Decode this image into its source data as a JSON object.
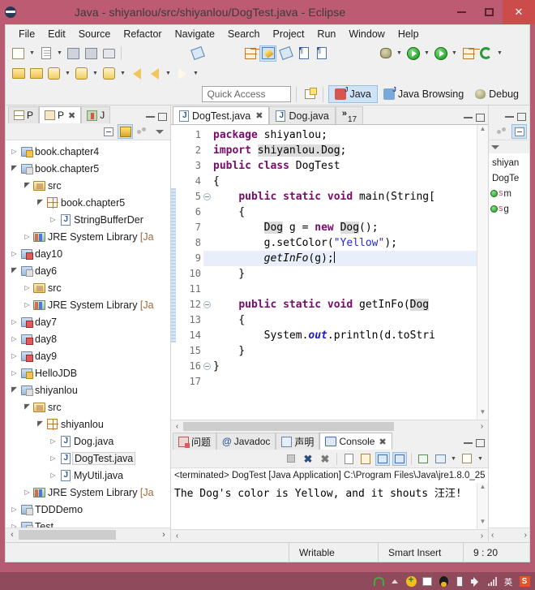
{
  "window": {
    "title": "Java - shiyanlou/src/shiyanlou/DogTest.java - Eclipse",
    "logo_icon": "eclipse-logo-icon",
    "minimize_label": "Minimize",
    "maximize_label": "Maximize",
    "close_label": "Close"
  },
  "menu": {
    "items": [
      {
        "label": "File"
      },
      {
        "label": "Edit"
      },
      {
        "label": "Source"
      },
      {
        "label": "Refactor"
      },
      {
        "label": "Navigate"
      },
      {
        "label": "Search"
      },
      {
        "label": "Project"
      },
      {
        "label": "Run"
      },
      {
        "label": "Window"
      },
      {
        "label": "Help"
      }
    ]
  },
  "toolbar": {
    "row1_icons": [
      "new-wizard-icon",
      "new-dropdown-icon",
      "new-java-class-icon",
      "new-class-dropdown-icon",
      "save-icon",
      "save-all-icon",
      "print-icon",
      "toggle-mark-occurrences-icon",
      "new-java-project-icon",
      "open-type-icon",
      "external-tools-icon",
      "show-whitespace-icon",
      "show-print-margin-icon",
      "debug-icon",
      "debug-dropdown-icon",
      "run-icon",
      "run-dropdown-icon",
      "run-external-tools-icon",
      "external-dropdown-icon",
      "new-package-icon",
      "refresh-icon",
      "refresh-dropdown-icon"
    ],
    "row2_icons": [
      "open-resource-icon",
      "open-folder-icon",
      "launch-icon",
      "launch-dropdown-icon",
      "previous-annotation-icon",
      "prev-dropdown-icon",
      "next-annotation-icon",
      "next-dropdown-icon",
      "back-history-icon",
      "back-icon",
      "back-dropdown-icon",
      "forward-icon",
      "forward-dropdown-icon"
    ]
  },
  "quick_access": {
    "placeholder": "Quick Access",
    "value": "Quick Access",
    "open_perspective_icon": "open-perspective-icon",
    "perspectives": [
      {
        "label": "Java",
        "icon": "java-perspective-icon",
        "active": true
      },
      {
        "label": "Java Browsing",
        "icon": "java-browsing-perspective-icon",
        "active": false
      },
      {
        "label": "Debug",
        "icon": "debug-perspective-icon",
        "active": false
      }
    ]
  },
  "package_explorer": {
    "tabs": [
      {
        "label": "P",
        "icon": "package-presentation-icon",
        "active": false,
        "closeable": false
      },
      {
        "label": "P",
        "icon": "package-explorer-icon",
        "active": true,
        "closeable": true
      },
      {
        "label": "J",
        "icon": "junit-icon",
        "active": false,
        "closeable": false
      }
    ],
    "toolbar_icons": [
      "collapse-all-icon",
      "link-with-editor-icon",
      "view-menu-dots-icon",
      "view-menu-icon"
    ],
    "tree": [
      {
        "indent": 0,
        "twisty": "collapsed",
        "icon": "project-warning-icon",
        "label": "book.chapter4"
      },
      {
        "indent": 0,
        "twisty": "expanded",
        "icon": "project-icon",
        "label": "book.chapter5"
      },
      {
        "indent": 1,
        "twisty": "expanded",
        "icon": "source-folder-icon",
        "label": "src"
      },
      {
        "indent": 2,
        "twisty": "expanded",
        "icon": "package-icon",
        "label": "book.chapter5"
      },
      {
        "indent": 3,
        "twisty": "collapsed",
        "icon": "java-file-icon",
        "label": "StringBufferDer"
      },
      {
        "indent": 1,
        "twisty": "collapsed",
        "icon": "jre-library-icon",
        "label": "JRE System Library ",
        "dim": "[Ja"
      },
      {
        "indent": 0,
        "twisty": "collapsed",
        "icon": "project-error-icon",
        "label": "day10"
      },
      {
        "indent": 0,
        "twisty": "expanded",
        "icon": "project-icon",
        "label": "day6"
      },
      {
        "indent": 1,
        "twisty": "collapsed",
        "icon": "source-folder-icon",
        "label": "src"
      },
      {
        "indent": 1,
        "twisty": "collapsed",
        "icon": "jre-library-icon",
        "label": "JRE System Library ",
        "dim": "[Ja"
      },
      {
        "indent": 0,
        "twisty": "collapsed",
        "icon": "project-error-icon",
        "label": "day7"
      },
      {
        "indent": 0,
        "twisty": "collapsed",
        "icon": "project-error-icon",
        "label": "day8"
      },
      {
        "indent": 0,
        "twisty": "collapsed",
        "icon": "project-error-icon",
        "label": "day9"
      },
      {
        "indent": 0,
        "twisty": "collapsed",
        "icon": "project-warning-icon",
        "label": "HelloJDB"
      },
      {
        "indent": 0,
        "twisty": "expanded",
        "icon": "project-icon",
        "label": "shiyanlou"
      },
      {
        "indent": 1,
        "twisty": "expanded",
        "icon": "source-folder-icon",
        "label": "src"
      },
      {
        "indent": 2,
        "twisty": "expanded",
        "icon": "package-icon",
        "label": "shiyanlou"
      },
      {
        "indent": 3,
        "twisty": "collapsed",
        "icon": "java-file-icon",
        "label": "Dog.java"
      },
      {
        "indent": 3,
        "twisty": "collapsed",
        "icon": "java-file-icon",
        "label": "DogTest.java",
        "selected": true
      },
      {
        "indent": 3,
        "twisty": "collapsed",
        "icon": "java-file-icon",
        "label": "MyUtil.java"
      },
      {
        "indent": 1,
        "twisty": "collapsed",
        "icon": "jre-library-icon",
        "label": "JRE System Library ",
        "dim": "[Ja"
      },
      {
        "indent": 0,
        "twisty": "collapsed",
        "icon": "project-icon",
        "label": "TDDDemo"
      },
      {
        "indent": 0,
        "twisty": "collapsed",
        "icon": "project-icon",
        "label": "Test"
      }
    ]
  },
  "editor": {
    "tabs": [
      {
        "label": "DogTest.java",
        "icon": "java-file-icon",
        "active": true,
        "closeable": true
      },
      {
        "label": "Dog.java",
        "icon": "java-file-icon",
        "active": false,
        "closeable": false
      }
    ],
    "overflow": {
      "chevron": "»",
      "count": "17"
    },
    "minimize_label": "Minimize",
    "maximize_label": "Maximize",
    "line_numbers": [
      "1",
      "2",
      "3",
      "4",
      "5",
      "6",
      "7",
      "8",
      "9",
      "10",
      "11",
      "12",
      "13",
      "14",
      "15",
      "16",
      "17"
    ],
    "fold_lines": [
      "5",
      "12",
      "16"
    ],
    "current_line": "9",
    "lines": [
      {
        "n": "1",
        "tokens": [
          {
            "t": "package ",
            "c": "kw"
          },
          {
            "t": "shiyanlou;",
            "c": ""
          }
        ]
      },
      {
        "n": "2",
        "tokens": [
          {
            "t": "import ",
            "c": "kw"
          },
          {
            "t": "shiyanlou.Dog",
            "c": "occ"
          },
          {
            "t": ";",
            "c": ""
          }
        ]
      },
      {
        "n": "3",
        "tokens": [
          {
            "t": "public class ",
            "c": "kw"
          },
          {
            "t": "DogTest",
            "c": ""
          }
        ]
      },
      {
        "n": "4",
        "tokens": [
          {
            "t": "{",
            "c": ""
          }
        ]
      },
      {
        "n": "5",
        "tokens": [
          {
            "t": "    ",
            "c": ""
          },
          {
            "t": "public static void ",
            "c": "kw"
          },
          {
            "t": "main(String[",
            "c": ""
          }
        ]
      },
      {
        "n": "6",
        "tokens": [
          {
            "t": "    {",
            "c": ""
          }
        ]
      },
      {
        "n": "7",
        "tokens": [
          {
            "t": "        ",
            "c": ""
          },
          {
            "t": "Dog",
            "c": "occ"
          },
          {
            "t": " g = ",
            "c": ""
          },
          {
            "t": "new ",
            "c": "kw"
          },
          {
            "t": "Dog",
            "c": "occ"
          },
          {
            "t": "();",
            "c": ""
          }
        ]
      },
      {
        "n": "8",
        "tokens": [
          {
            "t": "        g.setColor(",
            "c": ""
          },
          {
            "t": "\"Yellow\"",
            "c": "str"
          },
          {
            "t": ");",
            "c": ""
          }
        ]
      },
      {
        "n": "9",
        "tokens": [
          {
            "t": "        ",
            "c": ""
          },
          {
            "t": "getInFo",
            "c": "mth"
          },
          {
            "t": "(g);",
            "c": ""
          }
        ]
      },
      {
        "n": "10",
        "tokens": [
          {
            "t": "    }",
            "c": ""
          }
        ]
      },
      {
        "n": "11",
        "tokens": [
          {
            "t": "",
            "c": ""
          }
        ]
      },
      {
        "n": "12",
        "tokens": [
          {
            "t": "    ",
            "c": ""
          },
          {
            "t": "public static void ",
            "c": "kw"
          },
          {
            "t": "getInFo(",
            "c": ""
          },
          {
            "t": "Dog",
            "c": "occ"
          },
          {
            "t": " ",
            "c": ""
          }
        ]
      },
      {
        "n": "13",
        "tokens": [
          {
            "t": "    {",
            "c": ""
          }
        ]
      },
      {
        "n": "14",
        "tokens": [
          {
            "t": "        System.",
            "c": ""
          },
          {
            "t": "out",
            "c": "fld"
          },
          {
            "t": ".println(d.toStri",
            "c": ""
          }
        ]
      },
      {
        "n": "15",
        "tokens": [
          {
            "t": "    }",
            "c": ""
          }
        ]
      },
      {
        "n": "16",
        "tokens": [
          {
            "t": "}",
            "c": ""
          }
        ]
      },
      {
        "n": "17",
        "tokens": [
          {
            "t": "",
            "c": ""
          }
        ]
      }
    ]
  },
  "console": {
    "tabs": [
      {
        "label": "问题",
        "icon": "problems-icon",
        "active": false,
        "closeable": false
      },
      {
        "label": "Javadoc",
        "icon": "javadoc-at-icon",
        "active": false,
        "closeable": false
      },
      {
        "label": "声明",
        "icon": "declaration-icon",
        "active": false,
        "closeable": false
      },
      {
        "label": "Console",
        "icon": "console-icon",
        "active": true,
        "closeable": true
      }
    ],
    "toolbar_icons": [
      "terminate-icon",
      "remove-launch-icon",
      "remove-all-terminated-icon",
      "clear-console-icon",
      "scroll-lock-icon",
      "show-console-on-output-icon",
      "show-console-on-error-icon",
      "pin-console-icon",
      "display-selected-console-icon",
      "display-dropdown-icon",
      "open-console-icon",
      "open-console-dropdown-icon"
    ],
    "launch_line": "<terminated> DogTest [Java Application] C:\\Program Files\\Java\\jre1.8.0_25",
    "output": "The Dog's color is Yellow, and it shouts 汪汪!"
  },
  "outline": {
    "minimize_label": "Minimize",
    "maximize_label": "Maximize",
    "toolbar_icons": [
      "sort-icon",
      "hide-fields-icon",
      "view-menu-icon"
    ],
    "rows": [
      {
        "icon": "package-icon",
        "label": "shiyan"
      },
      {
        "icon": "class-icon",
        "label": "DogTe"
      },
      {
        "icon": "method-public-static-icon",
        "mod": "S",
        "label": "m"
      },
      {
        "icon": "method-public-static-icon",
        "mod": "S",
        "label": "g"
      }
    ],
    "scroll_left": "‹",
    "scroll_right": "›"
  },
  "status_bar": {
    "writable": "Writable",
    "insert_mode": "Smart Insert",
    "position": "9 : 20"
  },
  "taskbar": {
    "tray_icons": [
      "wifi-icon",
      "show-hidden-icons-icon",
      "update-icon",
      "flag-icon",
      "qq-penguin-icon",
      "battery-icon",
      "volume-icon",
      "signal-icon",
      "ime-chinese-icon",
      "sogou-icon"
    ],
    "ime_label": "英"
  },
  "colors": {
    "titlebar": "#bc5b72",
    "close_button": "#cc4b4b",
    "accent_selection": "#cfe3f7",
    "keyword": "#7a0a6b",
    "string": "#2a2ac8",
    "field": "#1a1acd"
  }
}
